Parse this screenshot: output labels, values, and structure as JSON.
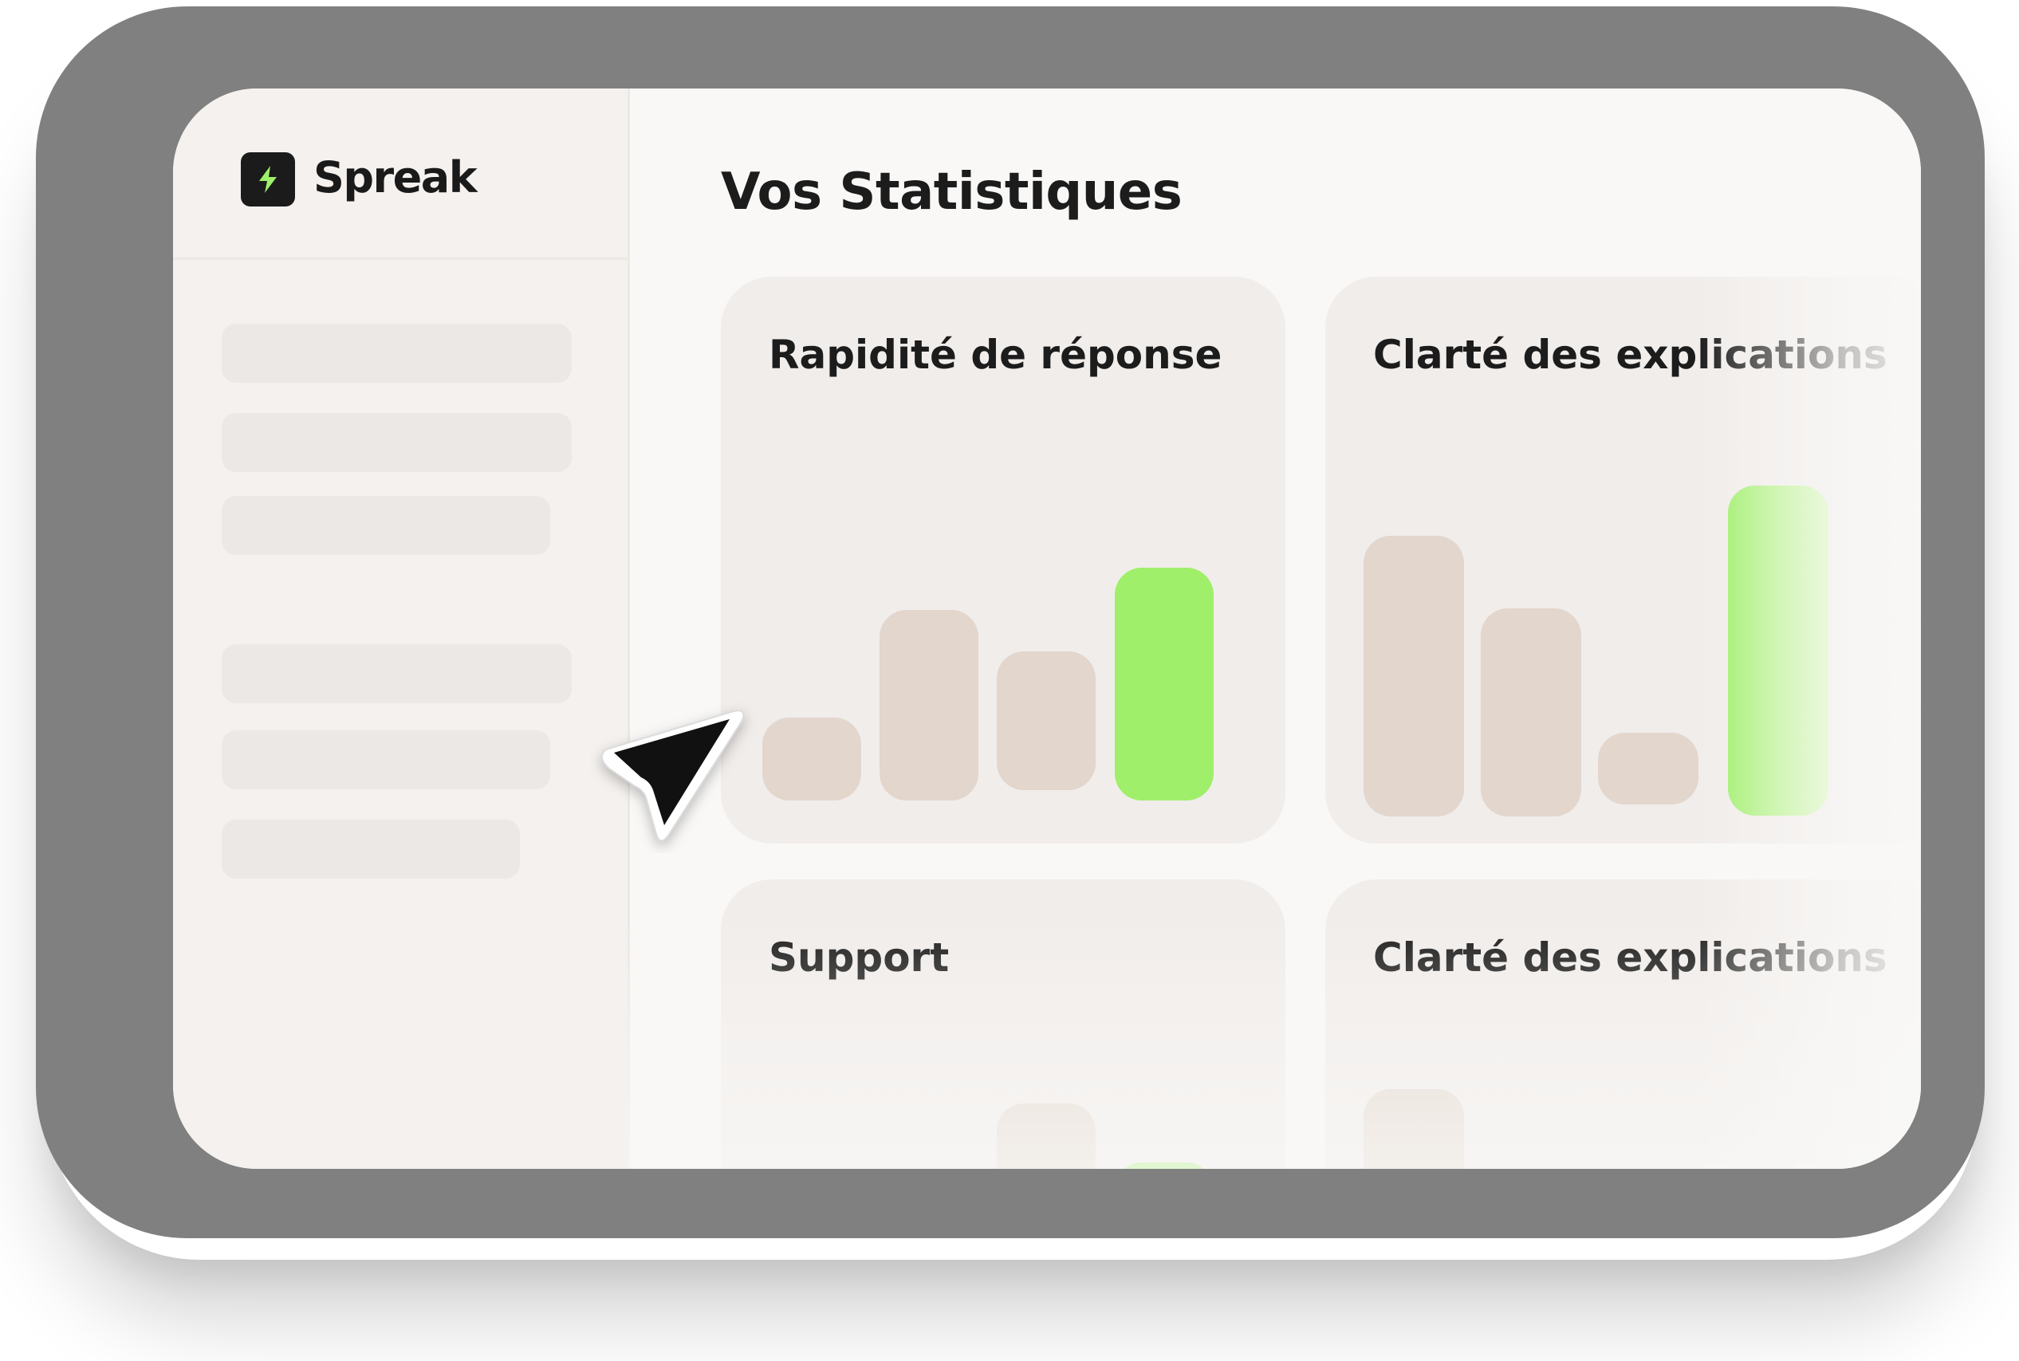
{
  "app": {
    "name": "Spreak",
    "logo_icon": "lightning-bolt-icon",
    "accent_color": "#9fef6a"
  },
  "main": {
    "title": "Vos Statistiques"
  },
  "cards": [
    {
      "title": "Rapidité de réponse",
      "bars": [
        0.33,
        0.82,
        0.6,
        1.0
      ],
      "highlight_index": 3
    },
    {
      "title": "Clarté des explications",
      "bars": [
        0.85,
        0.63,
        0.2,
        1.0
      ],
      "highlight_index": 3
    },
    {
      "title": "Support"
    },
    {
      "title": "Clarté des explications"
    }
  ],
  "cursor_icon": "pointer-arrow-icon"
}
